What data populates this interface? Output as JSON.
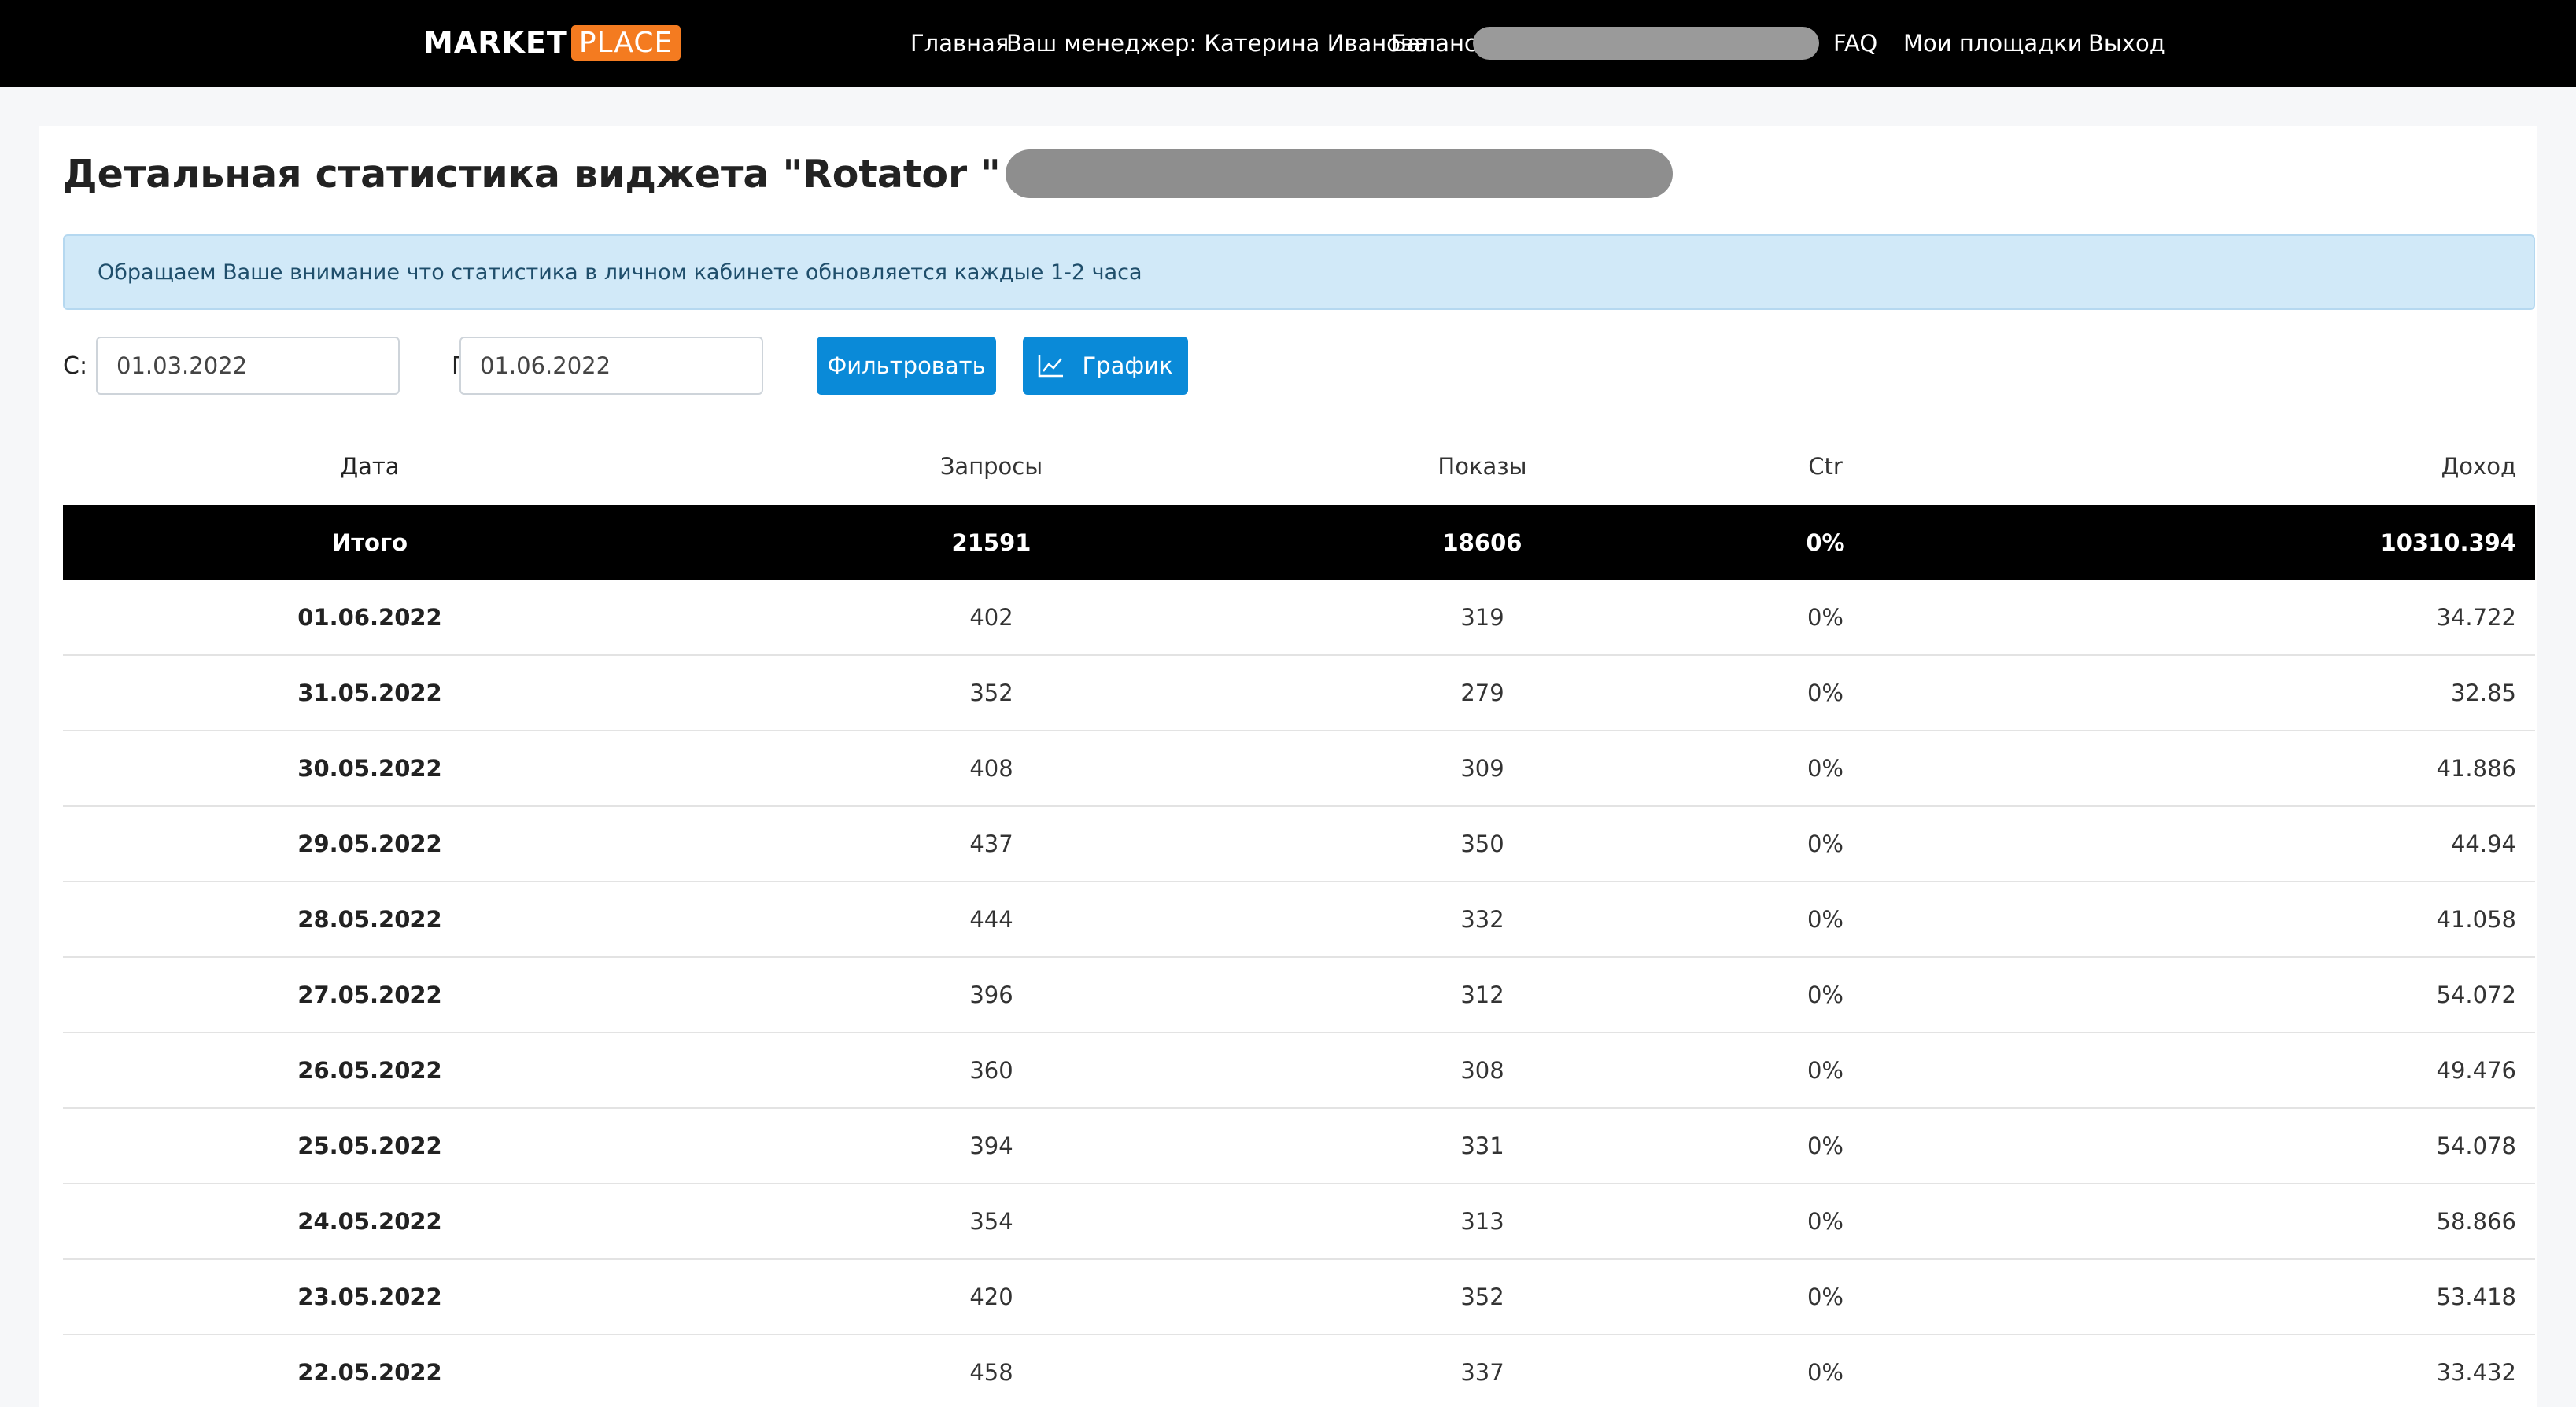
{
  "nav": {
    "logo_market": "MARKET",
    "logo_place": "PLACE",
    "home": "Главная",
    "manager": "Ваш менеджер: Катерина Иванова",
    "balance_label": "Баланс:",
    "faq": "FAQ",
    "my_sites": "Мои площадки",
    "logout": "Выход"
  },
  "page": {
    "title": "Детальная статистика виджета \"Rotator \"",
    "notice": "Обращаем Ваше внимание что статистика в личном кабинете обновляется каждые 1-2 часа"
  },
  "filter": {
    "from_label": "С:",
    "from_value": "01.03.2022",
    "to_label": "По:",
    "to_value": "01.06.2022",
    "filter_button": "Фильтровать",
    "chart_button": "График",
    "chart_icon": "line-chart-icon"
  },
  "table": {
    "headers": {
      "date": "Дата",
      "requests": "Запросы",
      "shows": "Показы",
      "ctr": "Ctr",
      "income": "Доход"
    },
    "total": {
      "date": "Итого",
      "requests": "21591",
      "shows": "18606",
      "ctr": "0%",
      "income": "10310.394"
    },
    "rows": [
      {
        "date": "01.06.2022",
        "requests": "402",
        "shows": "319",
        "ctr": "0%",
        "income": "34.722"
      },
      {
        "date": "31.05.2022",
        "requests": "352",
        "shows": "279",
        "ctr": "0%",
        "income": "32.85"
      },
      {
        "date": "30.05.2022",
        "requests": "408",
        "shows": "309",
        "ctr": "0%",
        "income": "41.886"
      },
      {
        "date": "29.05.2022",
        "requests": "437",
        "shows": "350",
        "ctr": "0%",
        "income": "44.94"
      },
      {
        "date": "28.05.2022",
        "requests": "444",
        "shows": "332",
        "ctr": "0%",
        "income": "41.058"
      },
      {
        "date": "27.05.2022",
        "requests": "396",
        "shows": "312",
        "ctr": "0%",
        "income": "54.072"
      },
      {
        "date": "26.05.2022",
        "requests": "360",
        "shows": "308",
        "ctr": "0%",
        "income": "49.476"
      },
      {
        "date": "25.05.2022",
        "requests": "394",
        "shows": "331",
        "ctr": "0%",
        "income": "54.078"
      },
      {
        "date": "24.05.2022",
        "requests": "354",
        "shows": "313",
        "ctr": "0%",
        "income": "58.866"
      },
      {
        "date": "23.05.2022",
        "requests": "420",
        "shows": "352",
        "ctr": "0%",
        "income": "53.418"
      },
      {
        "date": "22.05.2022",
        "requests": "458",
        "shows": "337",
        "ctr": "0%",
        "income": "33.432"
      }
    ]
  },
  "colors": {
    "navbar": "#000000",
    "logo_accent": "#f47b20",
    "button": "#0a8ad8",
    "alert_bg": "#d1e9f8"
  }
}
